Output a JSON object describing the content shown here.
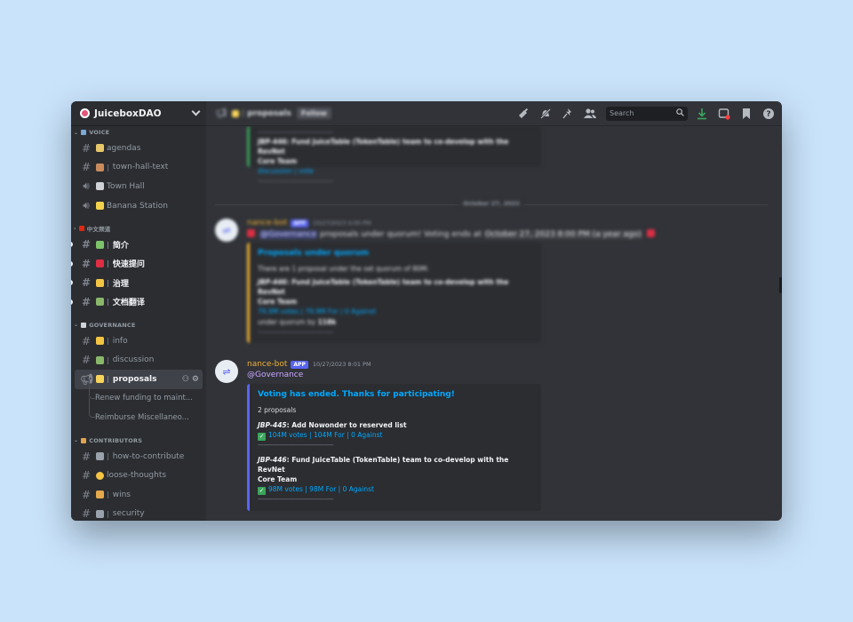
{
  "server": {
    "name": "JuiceboxDAO"
  },
  "sidebar": {
    "categories": {
      "voice": "VOICE",
      "chinese": "中文频道",
      "governance": "GOVERNANCE",
      "contributors": "CONTRIBUTORS"
    },
    "voice_channels": [
      {
        "label": "agendas"
      },
      {
        "label": "town-hall-text"
      },
      {
        "label": "Town Hall"
      },
      {
        "label": "Banana Station"
      }
    ],
    "chinese_channels": [
      {
        "label": "简介"
      },
      {
        "label": "快速提问"
      },
      {
        "label": "治理"
      },
      {
        "label": "文档翻译"
      }
    ],
    "governance_channels": [
      {
        "label": "info"
      },
      {
        "label": "discussion"
      },
      {
        "label": "proposals"
      }
    ],
    "threads": [
      {
        "label": "Renew funding to maint..."
      },
      {
        "label": "Reimburse Miscellaneo..."
      }
    ],
    "contributor_channels": [
      {
        "label": "how-to-contribute"
      },
      {
        "label": "loose-thoughts"
      },
      {
        "label": "wins"
      },
      {
        "label": "security"
      }
    ]
  },
  "topbar": {
    "channel": "proposals",
    "follow": "Follow",
    "search_placeholder": "Search"
  },
  "messages": {
    "top_embed": {
      "line1": "JBP-446: Fund JuiceTable (TokenTable) team to co-develop with the RevNet",
      "line2": "Core Team",
      "links": "discussion | vote",
      "dash": "------------------------------------------"
    },
    "date_divider": "October 27, 2023",
    "msg1": {
      "author": "nance-bot",
      "app_badge": "APP",
      "time": "10/27/2023 4:00 PM",
      "mention": "@Governance",
      "text": "proposals under quorum! Voting ends at",
      "timestamp": "October 27, 2023 8:00 PM (a year ago)",
      "embed": {
        "title": "Proposals under quorum",
        "intro": "There are 1 proposal under the set quorum of 80M:",
        "proposal_id": "JBP-446",
        "proposal_title": ": Fund JuiceTable (TokenTable) team to co-develop with the RevNet",
        "proposal_title2": "Core Team",
        "votes": "79.9M votes | 79.9M For | 0 Against",
        "under_label": "under quorum by",
        "under_value": "118k",
        "dash": "------------------------------------------"
      }
    },
    "msg2": {
      "author": "nance-bot",
      "app_badge": "APP",
      "time": "10/27/2023 8:01 PM",
      "mention": "@Governance",
      "embed": {
        "title": "Voting has ended. Thanks for participating!",
        "count": "2 proposals",
        "p1_id": "JBP-445",
        "p1_title": ": Add Nowonder to reserved list",
        "p1_votes": "104M votes | 104M For | 0 Against",
        "p2_id": "JBP-446",
        "p2_title": ": Fund JuiceTable (TokenTable) team to co-develop with the RevNet",
        "p2_title2": "Core Team",
        "p2_votes": "98M votes | 98M For | 0 Against",
        "dash": "------------------------------------------"
      }
    }
  },
  "colors": {
    "background": "#c9e3fb",
    "window": "#313338",
    "sidebar": "#2b2d31",
    "accent": "#5865f2",
    "link": "#00a8fc",
    "author": "#f0b232"
  }
}
